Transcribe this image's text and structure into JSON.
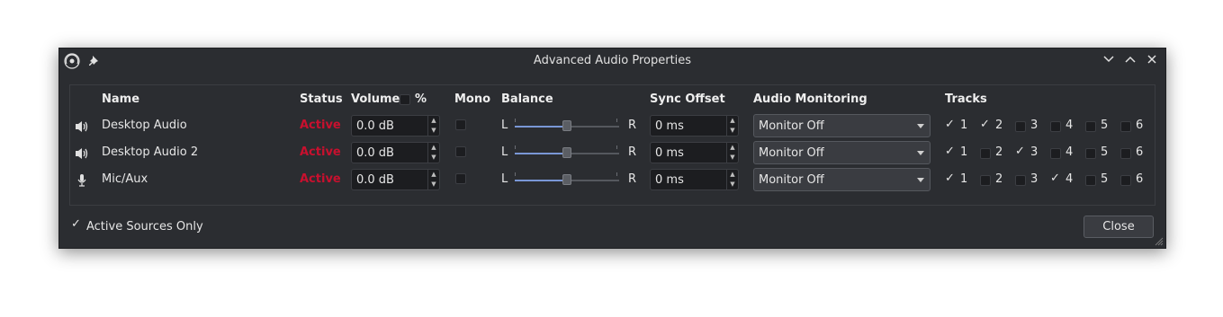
{
  "window": {
    "title": "Advanced Audio Properties"
  },
  "headers": {
    "name": "Name",
    "status": "Status",
    "volume": "Volume",
    "percent": "%",
    "mono": "Mono",
    "balance": "Balance",
    "sync": "Sync Offset",
    "monitoring": "Audio Monitoring",
    "tracks": "Tracks"
  },
  "rows": [
    {
      "icon": "speaker-icon",
      "name": "Desktop Audio",
      "status": "Active",
      "volume": "0.0 dB",
      "mono": false,
      "balance_L": "L",
      "balance_R": "R",
      "balance": 0.5,
      "sync": "0 ms",
      "monitoring": "Monitor Off",
      "tracks": [
        {
          "n": "1",
          "on": true
        },
        {
          "n": "2",
          "on": true
        },
        {
          "n": "3",
          "on": false
        },
        {
          "n": "4",
          "on": false
        },
        {
          "n": "5",
          "on": false
        },
        {
          "n": "6",
          "on": false
        }
      ]
    },
    {
      "icon": "speaker-icon",
      "name": "Desktop Audio 2",
      "status": "Active",
      "volume": "0.0 dB",
      "mono": false,
      "balance_L": "L",
      "balance_R": "R",
      "balance": 0.5,
      "sync": "0 ms",
      "monitoring": "Monitor Off",
      "tracks": [
        {
          "n": "1",
          "on": true
        },
        {
          "n": "2",
          "on": false
        },
        {
          "n": "3",
          "on": true
        },
        {
          "n": "4",
          "on": false
        },
        {
          "n": "5",
          "on": false
        },
        {
          "n": "6",
          "on": false
        }
      ]
    },
    {
      "icon": "microphone-icon",
      "name": "Mic/Aux",
      "status": "Active",
      "volume": "0.0 dB",
      "mono": false,
      "balance_L": "L",
      "balance_R": "R",
      "balance": 0.5,
      "sync": "0 ms",
      "monitoring": "Monitor Off",
      "tracks": [
        {
          "n": "1",
          "on": true
        },
        {
          "n": "2",
          "on": false
        },
        {
          "n": "3",
          "on": false
        },
        {
          "n": "4",
          "on": true
        },
        {
          "n": "5",
          "on": false
        },
        {
          "n": "6",
          "on": false
        }
      ]
    }
  ],
  "footer": {
    "active_only_label": "Active Sources Only",
    "active_only_checked": true,
    "close_label": "Close"
  },
  "colors": {
    "status_active": "#c8102e",
    "balance_fill": "#7a97d6",
    "window_bg": "#2b2d31"
  }
}
